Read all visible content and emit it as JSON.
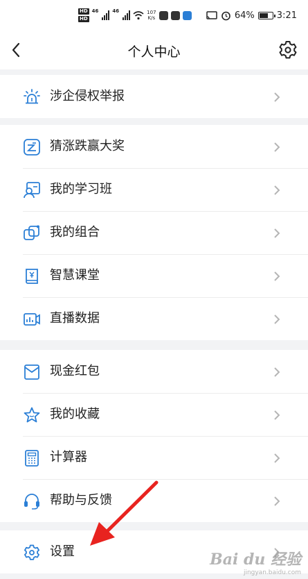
{
  "status_bar": {
    "hd1": "HD",
    "hd2": "HD",
    "sig1": "46",
    "sig2": "46",
    "net_speed": "107",
    "net_unit": "K/s",
    "battery": "64%",
    "time": "3:21"
  },
  "header": {
    "title": "个人中心"
  },
  "groups": [
    {
      "items": [
        {
          "label": "涉企侵权举报",
          "icon": "alarm-icon"
        }
      ]
    },
    {
      "items": [
        {
          "label": "猜涨跌赢大奖",
          "icon": "trend-icon"
        },
        {
          "label": "我的学习班",
          "icon": "student-icon"
        },
        {
          "label": "我的组合",
          "icon": "portfolio-icon"
        },
        {
          "label": "智慧课堂",
          "icon": "book-icon"
        },
        {
          "label": "直播数据",
          "icon": "live-data-icon"
        }
      ]
    },
    {
      "items": [
        {
          "label": "现金红包",
          "icon": "red-packet-icon"
        },
        {
          "label": "我的收藏",
          "icon": "star-icon"
        },
        {
          "label": "计算器",
          "icon": "calculator-icon"
        },
        {
          "label": "帮助与反馈",
          "icon": "headset-icon"
        }
      ]
    },
    {
      "items": [
        {
          "label": "设置",
          "icon": "gear-icon"
        }
      ]
    }
  ],
  "accent_color": "#2b7fd6",
  "annotation_color": "#e8231f",
  "watermark": {
    "brand": "Bai du 经验",
    "url": "jingyan.baidu.com"
  }
}
